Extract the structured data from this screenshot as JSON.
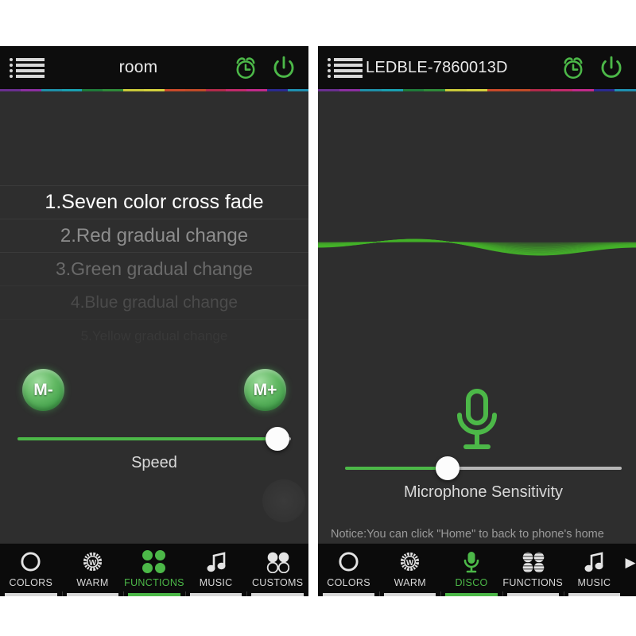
{
  "app": {
    "accent_green": "#4cb848",
    "bg": "#2e2e2e",
    "topbar_bg": "#0d0d0d"
  },
  "rainbow_strip": {
    "colors": [
      "#6a2f8f",
      "#8b2fa0",
      "#1f8fa8",
      "#1a9fb0",
      "#1f7a3a",
      "#2f8a3a",
      "#c8c83a",
      "#d2cf3d",
      "#c84a2a",
      "#c04a28",
      "#b02a4a",
      "#c02a6a",
      "#c02a8a",
      "#2a2a8f",
      "#1f8fb0"
    ]
  },
  "left_panel": {
    "header": {
      "menu_icon": "list-menu-icon",
      "title": "room",
      "alarm_icon": "alarm-clock-icon",
      "power_icon": "power-icon"
    },
    "modes": [
      {
        "label": "1.Seven color cross fade",
        "selected": true
      },
      {
        "label": "2.Red  gradual change",
        "selected": false
      },
      {
        "label": "3.Green gradual change",
        "selected": false
      },
      {
        "label": "4.Blue gradual change",
        "selected": false
      },
      {
        "label": "5.Yellow gradual change",
        "selected": false
      }
    ],
    "mode_minus_label": "M-",
    "mode_plus_label": "M+",
    "speed_slider": {
      "label": "Speed",
      "value": 95,
      "min": 0,
      "max": 100
    },
    "nav": {
      "items": [
        {
          "label": "COLORS",
          "icon": "circle-outline-icon",
          "active": false
        },
        {
          "label": "WARM",
          "icon": "warm-white-gear-icon",
          "active": false
        },
        {
          "label": "FUNCTIONS",
          "icon": "four-dots-icon",
          "active": true
        },
        {
          "label": "MUSIC",
          "icon": "music-note-icon",
          "active": false
        },
        {
          "label": "CUSTOMS",
          "icon": "four-circles-icon",
          "active": false
        }
      ]
    }
  },
  "right_panel": {
    "header": {
      "menu_icon": "list-menu-icon",
      "title": "LEDBLE-7860013D",
      "alarm_icon": "alarm-clock-icon",
      "power_icon": "power-icon"
    },
    "waveform": {
      "icon": "audio-waveform",
      "color": "#45b32a"
    },
    "mic_icon": "microphone-icon",
    "sensitivity_slider": {
      "label": "Microphone Sensitivity",
      "value": 37,
      "min": 0,
      "max": 100
    },
    "notice": "Notice:You can click \"Home\" to back to phone's home screen,and play music by any app.Then,your lighting will dance with music.",
    "nav": {
      "items": [
        {
          "label": "COLORS",
          "icon": "circle-outline-icon",
          "active": false
        },
        {
          "label": "WARM",
          "icon": "warm-white-gear-icon",
          "active": false
        },
        {
          "label": "DISCO",
          "icon": "microphone-icon",
          "active": true
        },
        {
          "label": "FUNCTIONS",
          "icon": "four-striped-circles-icon",
          "active": false
        },
        {
          "label": "MUSIC",
          "icon": "music-note-icon",
          "active": false
        }
      ],
      "more_arrow": "▶"
    }
  }
}
